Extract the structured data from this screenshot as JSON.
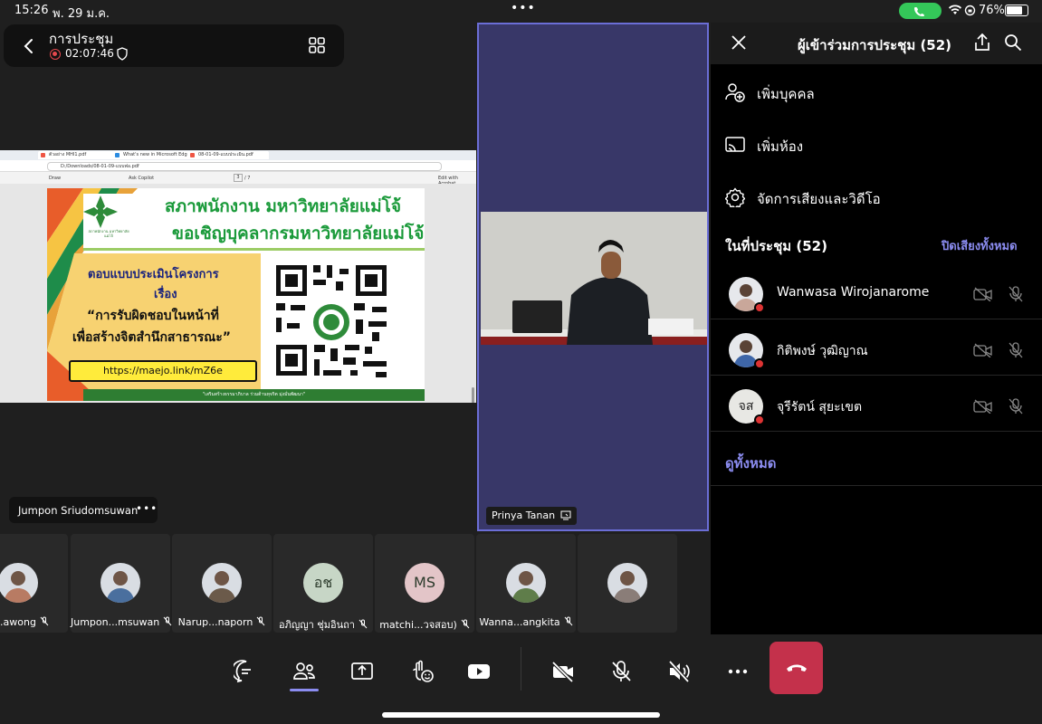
{
  "status_bar": {
    "time": "15:26",
    "date": "พ. 29 ม.ค.",
    "dots": "•••",
    "battery": "76%"
  },
  "header": {
    "title": "การประชุม",
    "timer": "02:07:46"
  },
  "shared_screen": {
    "tabs": [
      "ตัวอย่าง MHI1.pdf",
      "What's new in Microsoft Edge",
      "08-01-09-แบบประเมิน.pdf"
    ],
    "url": "D:/Downloads/08-01-09-แบบฟอ.pdf",
    "toolbar": {
      "draw": "Draw",
      "page_current": "3",
      "page_total": "/ 7",
      "ask_copilot": "Ask Copilot",
      "fill_acrobat": "Edit with Acrobat"
    },
    "slide": {
      "title_line_1": "สภาพนักงาน มหาวิทยาลัยแม่โจ้",
      "title_line_2": "ขอเชิญบุคลากรมหาวิทยาลัยแม่โจ้",
      "logo_text": "สภาพนักงาน มหาวิทยาลัยแม่โจ้",
      "line_1": "ตอบแบบประเมินโครงการ",
      "line_2": "เรื่อง",
      "line_3": "“การรับผิดชอบในหน้าที่",
      "line_4": "เพื่อสร้างจิตสำนึกสาธารณะ”",
      "link": "https://maejo.link/mZ6e",
      "footer": "\"เสริมสร้างธรรมาภิบาล ร่วมต้านทุจริต มุ่งมั่นพัฒนา\""
    }
  },
  "presenter": {
    "name": "Jumpon Sriudomsuwan",
    "more": "•••"
  },
  "video_tile": {
    "name": "Prinya Tanan"
  },
  "participants_strip": [
    {
      "name": "p...awong",
      "type": "photo",
      "color": "#b87b63"
    },
    {
      "name": "Jumpon...msuwan",
      "type": "photo",
      "color": "#4a6f9e"
    },
    {
      "name": "Narup...naporn",
      "type": "photo",
      "color": "#6b5a4a"
    },
    {
      "name": "อภิญญา ชุ่มอินถา",
      "type": "initials",
      "initials": "อช",
      "color": "#c7d6c6"
    },
    {
      "name": "matchi...วจสอบ)",
      "type": "initials",
      "initials": "MS",
      "color": "#e3c5c8"
    },
    {
      "name": "Wanna...angkita",
      "type": "photo",
      "color": "#5f7d4a"
    },
    {
      "name": "",
      "type": "photo",
      "color": "#8a7d78"
    }
  ],
  "panel": {
    "title": "ผู้เข้าร่วมการประชุม (52)",
    "actions": [
      {
        "label": "เพิ่มบุคคล",
        "icon": "add-person-icon"
      },
      {
        "label": "เพิ่มห้อง",
        "icon": "cast-room-icon"
      },
      {
        "label": "จัดการเสียงและวิดีโอ",
        "icon": "gear-icon"
      }
    ],
    "in_meeting": "ในที่ประชุม (52)",
    "mute_all": "ปิดเสียงทั้งหมด",
    "people": [
      {
        "name": "Wanwasa Wirojanarome",
        "type": "photo",
        "color": "#c9a79a"
      },
      {
        "name": "กิติพงษ์ วุฒิญาณ",
        "type": "photo",
        "color": "#3e66a8"
      },
      {
        "name": "จุรีรัตน์ สุยะเขต",
        "type": "initials",
        "initials": "จส",
        "color": "#e8e8e4"
      }
    ],
    "see_all": "ดูทั้งหมด"
  },
  "colors": {
    "accent": "#8b8cf0",
    "leave": "#c4314b",
    "video_bg": "#383768",
    "call_green": "#34c759"
  }
}
